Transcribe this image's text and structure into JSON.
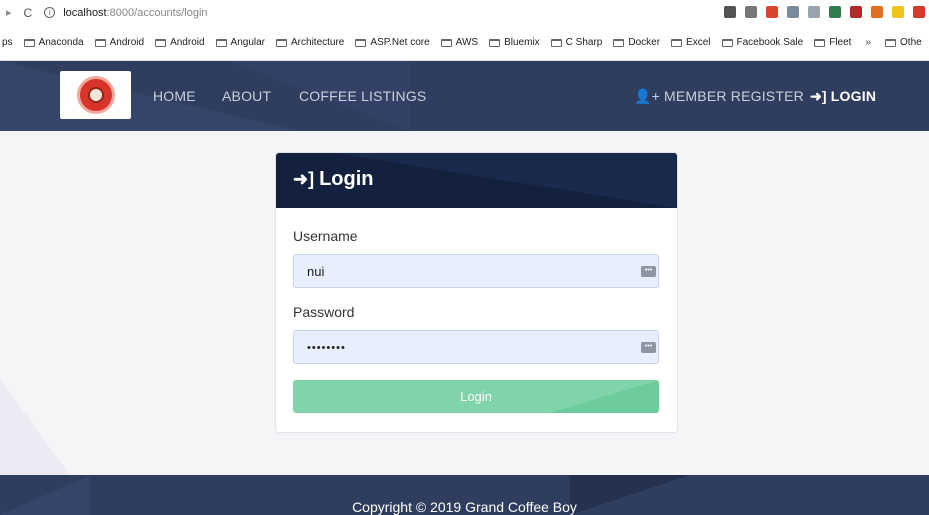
{
  "browser": {
    "back_glyph": "▸",
    "reload_glyph": "C",
    "info_glyph": "i",
    "url_host": "localhost",
    "url_path": ":8000/accounts/login",
    "bookmarks": [
      "Anaconda",
      "Android",
      "Android",
      "Angular",
      "Architecture",
      "ASP.Net core",
      "AWS",
      "Bluemix",
      "C Sharp",
      "Docker",
      "Excel",
      "Facebook Sale",
      "Fleet"
    ],
    "bookmarks_prefix": "ps",
    "more_label": "»",
    "other_label": "Othe",
    "extension_icons": [
      "key-icon",
      "star-icon",
      "office-icon",
      "circle-icon",
      "triangle-icon",
      "shield-icon",
      "dot-icon",
      "pie-icon",
      "message-icon",
      "s-icon"
    ],
    "extension_colors": [
      "#555555",
      "#777777",
      "#d9452f",
      "#7a8a9a",
      "#9aa4ae",
      "#2e7d4f",
      "#b02a2a",
      "#e0701f",
      "#f0c21a",
      "#d23b2b"
    ]
  },
  "navbar": {
    "logo_icon": "grand-coffee-boy-logo",
    "links": {
      "home": "HOME",
      "about": "ABOUT",
      "listings": "COFFEE LISTINGS",
      "register": "MEMBER REGISTER",
      "login": "LOGIN"
    },
    "register_icon_glyph": "👤+",
    "login_icon_glyph": "➜]"
  },
  "login_card": {
    "title": "Login",
    "title_icon_glyph": "➜]",
    "username_label": "Username",
    "username_value": "nui",
    "password_label": "Password",
    "password_value": "••••••••",
    "field_icon_glyph": "•••",
    "submit_label": "Login"
  },
  "footer": {
    "copyright": "Copyright © 2019 Grand Coffee Boy"
  },
  "colors": {
    "navbar": "#2f3e5e",
    "card_header": "#13213f",
    "login_button": "#7fd5a9",
    "input_bg": "#e8eefc"
  }
}
